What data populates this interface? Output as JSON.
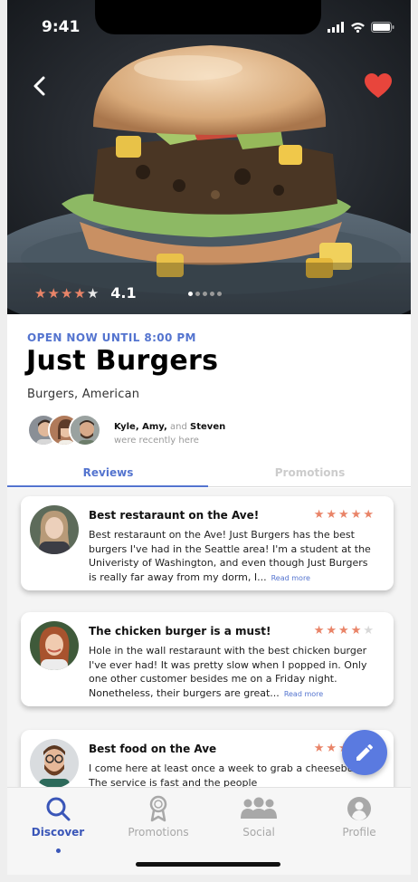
{
  "status_bar": {
    "time": "9:41"
  },
  "hero": {
    "rating_value": "4.1",
    "rating_stars": 4,
    "image_count": 5,
    "image_index": 0
  },
  "restaurant": {
    "open_status": "OPEN NOW UNTIL 8:00 PM",
    "name": "Just Burgers",
    "cuisine": "Burgers, American"
  },
  "friends": {
    "name1": "Kyle, Amy,",
    "and_word": "and",
    "name2": "Steven",
    "subtitle": "were recently here"
  },
  "tabs": [
    {
      "label": "Reviews",
      "active": true
    },
    {
      "label": "Promotions",
      "active": false
    }
  ],
  "reviews": [
    {
      "title": "Best restaraunt on the Ave!",
      "stars": 5,
      "body": "Best restaraunt on the Ave! Just Burgers has the best burgers I've had in the Seattle area! I'm a student at the Univeristy of Washington, and even though Just Burgers is really far away from my dorm, I...",
      "more": "Read more"
    },
    {
      "title": "The chicken burger is a must!",
      "stars": 4,
      "body": "Hole in the wall restaraunt with the best chicken burger I've ever had! It was pretty slow when I popped in. Only one other customer besides me on a Friday night. Nonetheless, their burgers are great...",
      "more": "Read more"
    },
    {
      "title": "Best food on the Ave",
      "stars": 4,
      "body": "I come here at least once a week to grab a cheeseburger. The service is fast and the people",
      "more": ""
    }
  ],
  "bottom_nav": [
    {
      "label": "Discover",
      "icon": "search-icon",
      "active": true
    },
    {
      "label": "Promotions",
      "icon": "award-icon",
      "active": false
    },
    {
      "label": "Social",
      "icon": "people-icon",
      "active": false
    },
    {
      "label": "Profile",
      "icon": "user-icon",
      "active": false
    }
  ],
  "colors": {
    "accent": "#5474cf",
    "star": "#e98468",
    "heart": "#e8453c",
    "fab": "#5a7ae0"
  }
}
